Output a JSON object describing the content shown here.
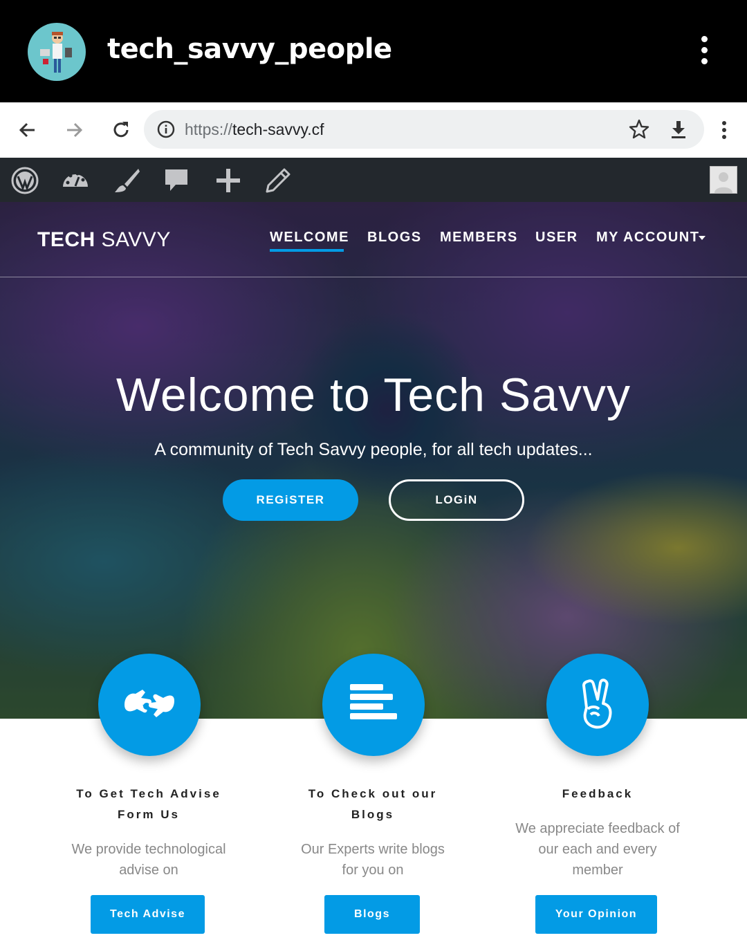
{
  "instagram": {
    "username": "tech_savvy_people"
  },
  "browser": {
    "url_protocol": "https://",
    "url_host": "tech-savvy.cf"
  },
  "site": {
    "brand_bold": "TECH",
    "brand_light": " SAVVY",
    "menu": [
      {
        "label": "WELCOME",
        "active": true
      },
      {
        "label": "BLOGS"
      },
      {
        "label": "MEMBERS"
      },
      {
        "label": "USER"
      },
      {
        "label": "MY ACCOUNT"
      }
    ],
    "hero_title": "Welcome to Tech Savvy",
    "hero_subtitle": "A community of Tech Savvy people, for all tech updates...",
    "register_label": "REGiSTER",
    "login_label": "LOGiN"
  },
  "features": [
    {
      "title_line1": "To Get Tech Advise",
      "title_line2": "Form Us",
      "desc_line1": "We provide technological",
      "desc_line2": "advise on",
      "button": "Tech Advise",
      "icon": "sign-language-icon"
    },
    {
      "title_line1": "To Check out our",
      "title_line2": "Blogs",
      "desc_line1": "Our Experts write blogs",
      "desc_line2": "for you on",
      "button": "Blogs",
      "icon": "align-left-icon"
    },
    {
      "title_line1": "Feedback",
      "desc_line1": "We appreciate feedback of",
      "desc_line2": "our each and every",
      "desc_line3": "member",
      "button": "Your Opinion",
      "icon": "peace-hand-icon"
    }
  ],
  "colors": {
    "accent": "#039be5",
    "ig_header": "#000000",
    "wp_bar": "#23282d"
  }
}
